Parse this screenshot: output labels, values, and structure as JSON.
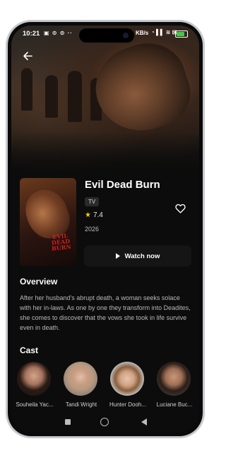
{
  "status_bar": {
    "time": "10:21",
    "left_icons": "▣ ⊙ ⊙ ··",
    "network_speed": "KB/s",
    "right_icons": "◔ ▌▌ ≋ ⊠",
    "battery_color": "#46c84a"
  },
  "header": {
    "back_icon": "arrow-left-icon"
  },
  "movie": {
    "title": "Evil Dead Burn",
    "type_badge": "TV",
    "rating": "7.4",
    "year": "2026",
    "poster_logo": "EVIL DEAD BURN",
    "favorite_icon": "heart-outline-icon",
    "watch_label": "Watch now"
  },
  "overview": {
    "heading": "Overview",
    "text": "After her husband's abrupt death, a woman seeks solace with her in-laws. As one by one they transform into Deadites, she comes to discover that the vows she took in life survive even in death."
  },
  "cast": {
    "heading": "Cast",
    "members": [
      {
        "name": "Souheila Yac..."
      },
      {
        "name": "Tandi Wright"
      },
      {
        "name": "Hunter Dooh..."
      },
      {
        "name": "Luciane Buc..."
      }
    ]
  },
  "colors": {
    "background": "#0c0c0c",
    "accent_star": "#f5c518",
    "title_red": "#d21f1f"
  }
}
